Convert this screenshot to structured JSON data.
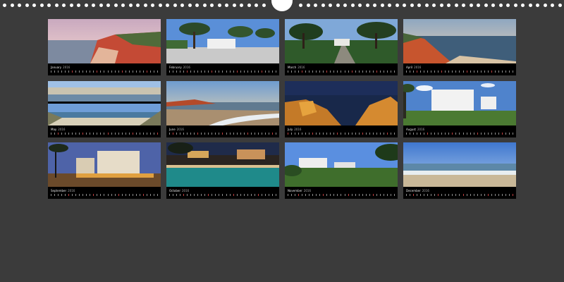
{
  "calendar": {
    "year_suffix": "2016",
    "months": [
      {
        "name": "January",
        "photo": "cliff-coast-dusk"
      },
      {
        "name": "February",
        "photo": "pine-plaza"
      },
      {
        "name": "March",
        "photo": "garden-path"
      },
      {
        "name": "April",
        "photo": "red-cliff-sea"
      },
      {
        "name": "May",
        "photo": "beach-panorama-split"
      },
      {
        "name": "June",
        "photo": "beach-waves-sunset"
      },
      {
        "name": "July",
        "photo": "cliffs-at-night"
      },
      {
        "name": "August",
        "photo": "white-hotel"
      },
      {
        "name": "September",
        "photo": "hotel-evening"
      },
      {
        "name": "October",
        "photo": "pool-night"
      },
      {
        "name": "November",
        "photo": "villas-on-hill"
      },
      {
        "name": "December",
        "photo": "calm-sea-shore"
      }
    ]
  },
  "colors": {
    "background": "#3b3b3b",
    "page": "#000000",
    "holes": "#ffffff"
  }
}
